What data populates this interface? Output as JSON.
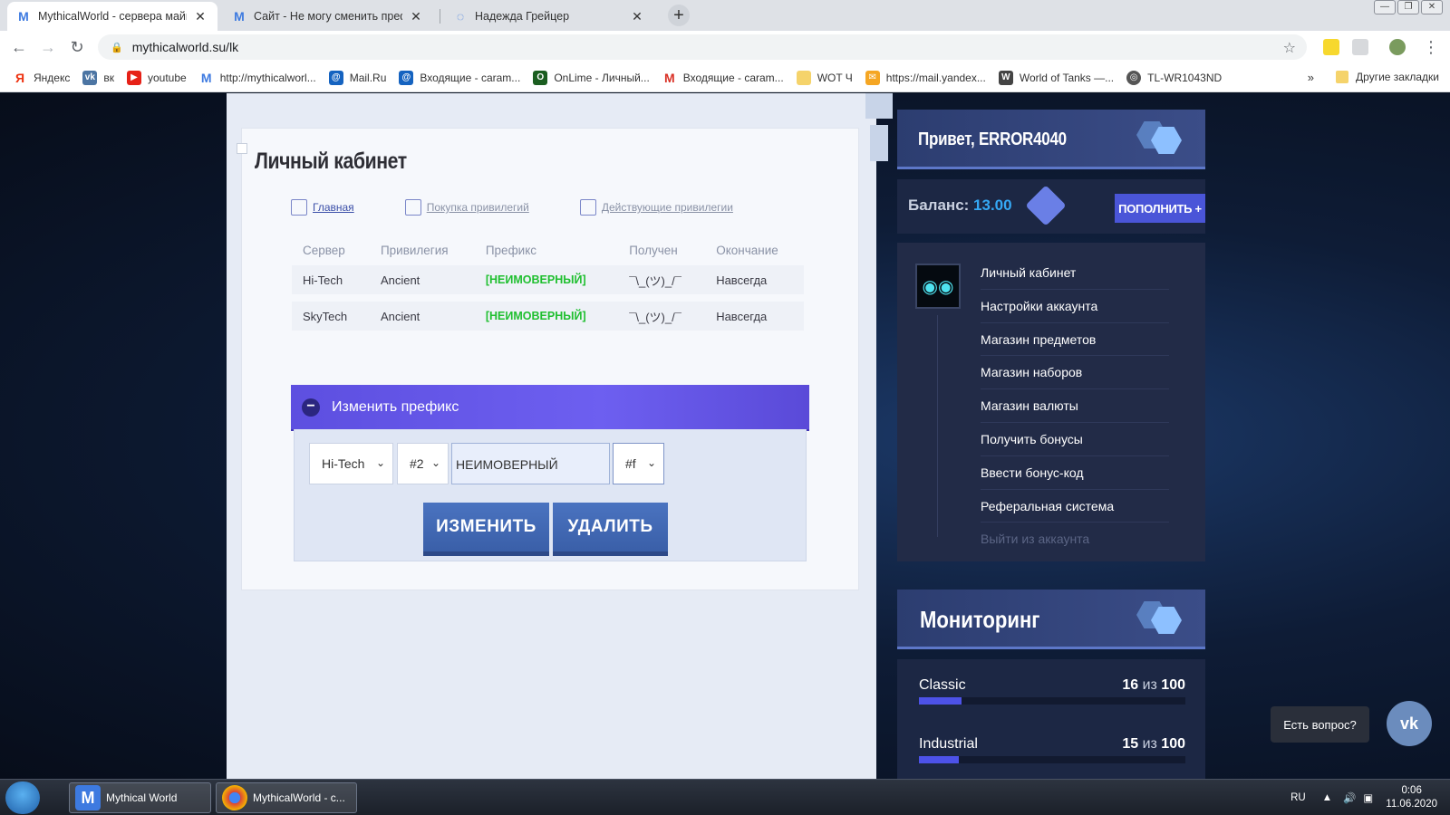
{
  "browser": {
    "tabs": [
      {
        "title": "MythicalWorld - сервера майнкр",
        "active": true
      },
      {
        "title": "Сайт - Не могу сменить префикс",
        "active": false
      },
      {
        "title": "Надежда Грейцер",
        "active": false
      }
    ],
    "url": "mythicalworld.su/lk",
    "bookmarks": [
      {
        "label": "Яндекс"
      },
      {
        "label": "вк"
      },
      {
        "label": "youtube"
      },
      {
        "label": "http://mythicalworl..."
      },
      {
        "label": "Mail.Ru"
      },
      {
        "label": "Входящие - caram..."
      },
      {
        "label": "OnLime - Личный..."
      },
      {
        "label": "Входящие - caram..."
      },
      {
        "label": "WOT Ч"
      },
      {
        "label": "https://mail.yandex..."
      },
      {
        "label": "World of Tanks —..."
      },
      {
        "label": "TL-WR1043ND"
      }
    ],
    "bookmarks_more": "»",
    "other_bookmarks": "Другие закладки"
  },
  "cabinet": {
    "title": "Личный кабинет",
    "nav": [
      {
        "label": "Главная"
      },
      {
        "label": "Покупка привилегий"
      },
      {
        "label": "Действующие привилегии"
      }
    ],
    "table": {
      "headers": [
        "Сервер",
        "Привилегия",
        "Префикс",
        "Получен",
        "Окончание"
      ],
      "rows": [
        [
          "Hi-Tech",
          "Ancient",
          "[НЕИМОВЕРНЫЙ]",
          "¯\\_(ツ)_/¯",
          "Навсегда"
        ],
        [
          "SkyTech",
          "Ancient",
          "[НЕИМОВЕРНЫЙ]",
          "¯\\_(ツ)_/¯",
          "Навсегда"
        ]
      ]
    },
    "change_prefix": {
      "title": "Изменить префикс",
      "toggle": "−",
      "server_select": "Hi-Tech",
      "number_select": "#2",
      "prefix_input": "НЕИМОВЕРНЫЙ",
      "color_select": "#f",
      "change_button": "ИЗМЕНИТЬ",
      "delete_button": "УДАЛИТЬ"
    }
  },
  "sidebar": {
    "greeting": "Привет, ERROR4040",
    "balance_label": "Баланс: ",
    "balance_value": "13.00",
    "topup_button": "ПОПОЛНИТЬ +",
    "menu": [
      "Личный кабинет",
      "Настройки аккаунта",
      "Магазин предметов",
      "Магазин наборов",
      "Магазин валюты",
      "Получить бонусы",
      "Ввести бонус-код",
      "Реферальная система",
      "Выйти из аккаунта"
    ],
    "monitoring_title": "Мониторинг",
    "servers": [
      {
        "name": "Classic",
        "online": "16",
        "of": " из ",
        "max": "100",
        "fill": 0.16
      },
      {
        "name": "Industrial",
        "online": "15",
        "of": " из ",
        "max": "100",
        "fill": 0.15
      }
    ]
  },
  "help": {
    "bubble": "Есть вопрос?",
    "vk": "vk"
  },
  "taskbar": {
    "tasks": [
      {
        "label": "Mythical World"
      },
      {
        "label": "MythicalWorld - c..."
      }
    ],
    "lang": "RU",
    "time": "0:06",
    "date": "11.06.2020"
  },
  "colors": {
    "accent": "#6d5ff0",
    "prefix_green": "#1fbf2f",
    "balance_blue": "#35a8f4",
    "sidebar_bg": "#222b47"
  }
}
